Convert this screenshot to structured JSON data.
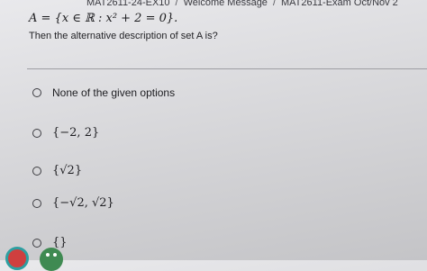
{
  "breadcrumb": {
    "items": [
      "MAT2611-24-EX10",
      "Welcome Message",
      "MAT2611-Exam Oct/Nov 2"
    ],
    "separator": "/"
  },
  "question": {
    "set_definition": "A = {x ∈ ℝ : x² + 2 = 0}.",
    "prompt": "Then the alternative description of set A is?"
  },
  "options": [
    {
      "label": "None of the given options"
    },
    {
      "label": "{−2, 2}"
    },
    {
      "label": "{√2}"
    },
    {
      "label": "{−√2, √2}"
    },
    {
      "label": "{}"
    }
  ],
  "colors": {
    "background": "#dcdcdf",
    "text": "#1f1f22",
    "divider": "#9e9ea3",
    "fab_left": "#cf3f3f",
    "fab_right": "#3f8a52"
  },
  "icons": {
    "fab_left": "app-launcher-icon",
    "fab_right": "assistant-icon"
  }
}
